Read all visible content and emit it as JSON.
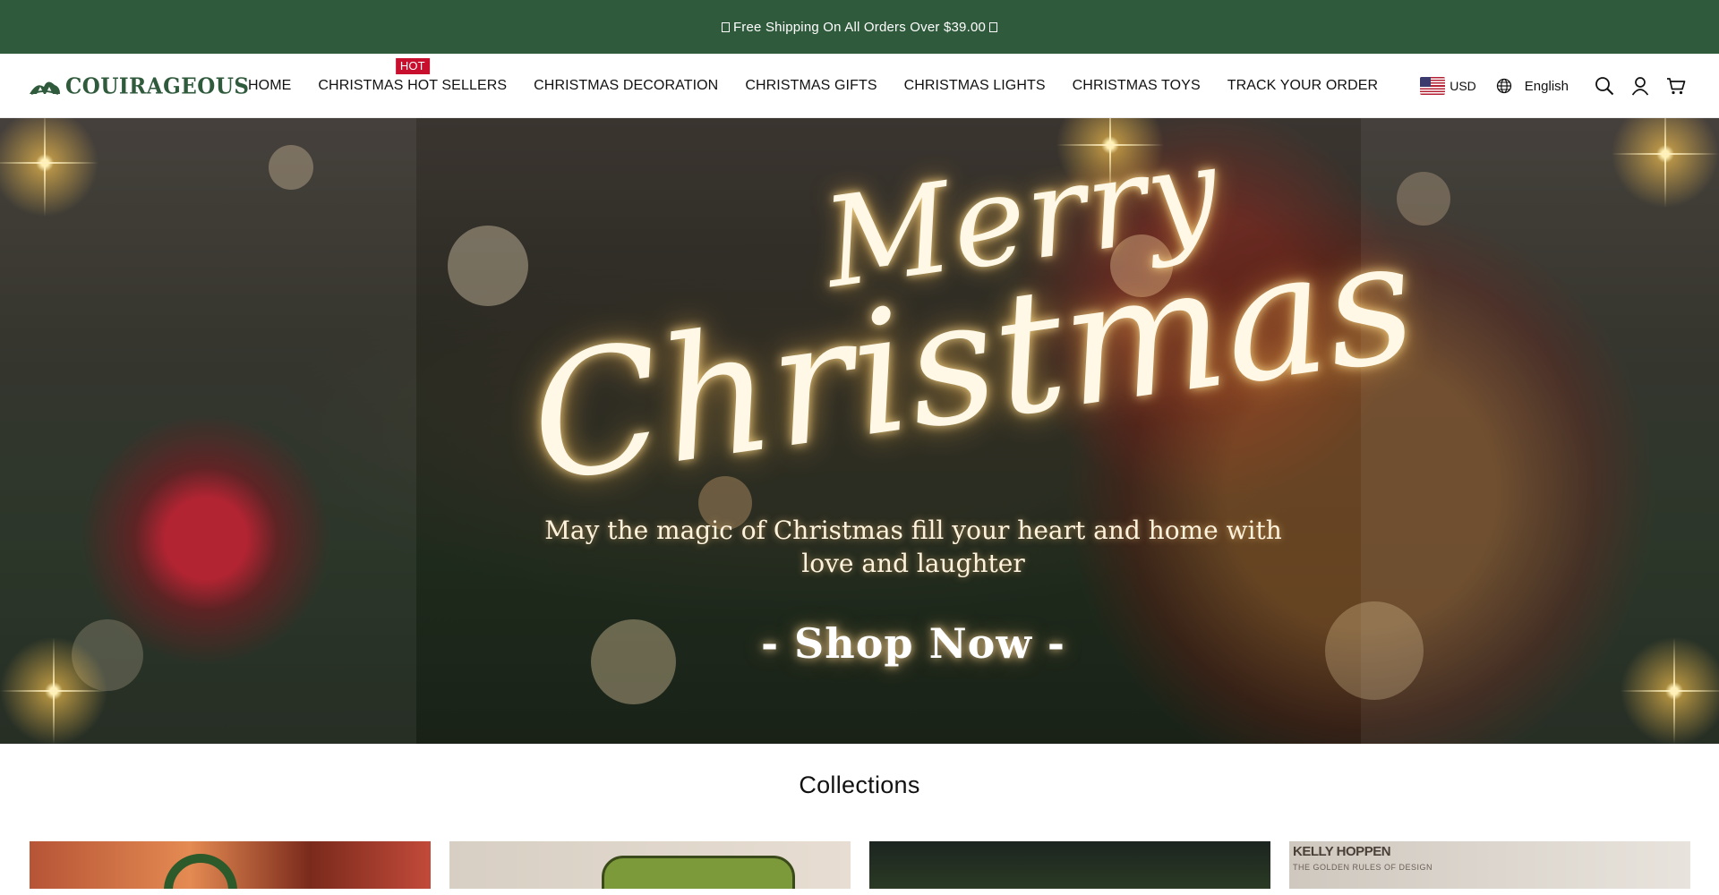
{
  "announcement": {
    "text": "Free Shipping On All Orders Over $39.00"
  },
  "brand": {
    "name": "COUIRAGEOUS",
    "color": "#2f5a3c"
  },
  "nav": {
    "items": [
      {
        "label": "HOME"
      },
      {
        "label": "CHRISTMAS HOT SELLERS",
        "badge": "HOT"
      },
      {
        "label": "CHRISTMAS DECORATION"
      },
      {
        "label": "CHRISTMAS GIFTS"
      },
      {
        "label": "CHRISTMAS LIGHTS"
      },
      {
        "label": "CHRISTMAS TOYS"
      },
      {
        "label": "TRACK YOUR ORDER"
      }
    ]
  },
  "header_right": {
    "currency": "USD",
    "flag_icon": "us-flag-icon",
    "language": "English",
    "icons": [
      "globe-icon",
      "search-icon",
      "account-icon",
      "cart-icon"
    ]
  },
  "hero": {
    "title_line1": "Merry",
    "title_line2": "Christmas",
    "tagline_line1": "May the magic of Christmas fill your heart and home with",
    "tagline_line2": "love and laughter",
    "cta": "- Shop Now -"
  },
  "collections": {
    "title": "Collections",
    "cards": [
      {
        "image": "christmas-wreath-photo"
      },
      {
        "image": "green-phone-case-photo"
      },
      {
        "image": "outdoor-hedge-photo"
      },
      {
        "image": "kelly-hoppen-book-photo",
        "text": "KELLY HOPPEN",
        "subtext": "THE GOLDEN RULES OF DESIGN"
      }
    ]
  },
  "colors": {
    "announcement_bg": "#2f5a3c",
    "hot_badge": "#c8102e"
  }
}
